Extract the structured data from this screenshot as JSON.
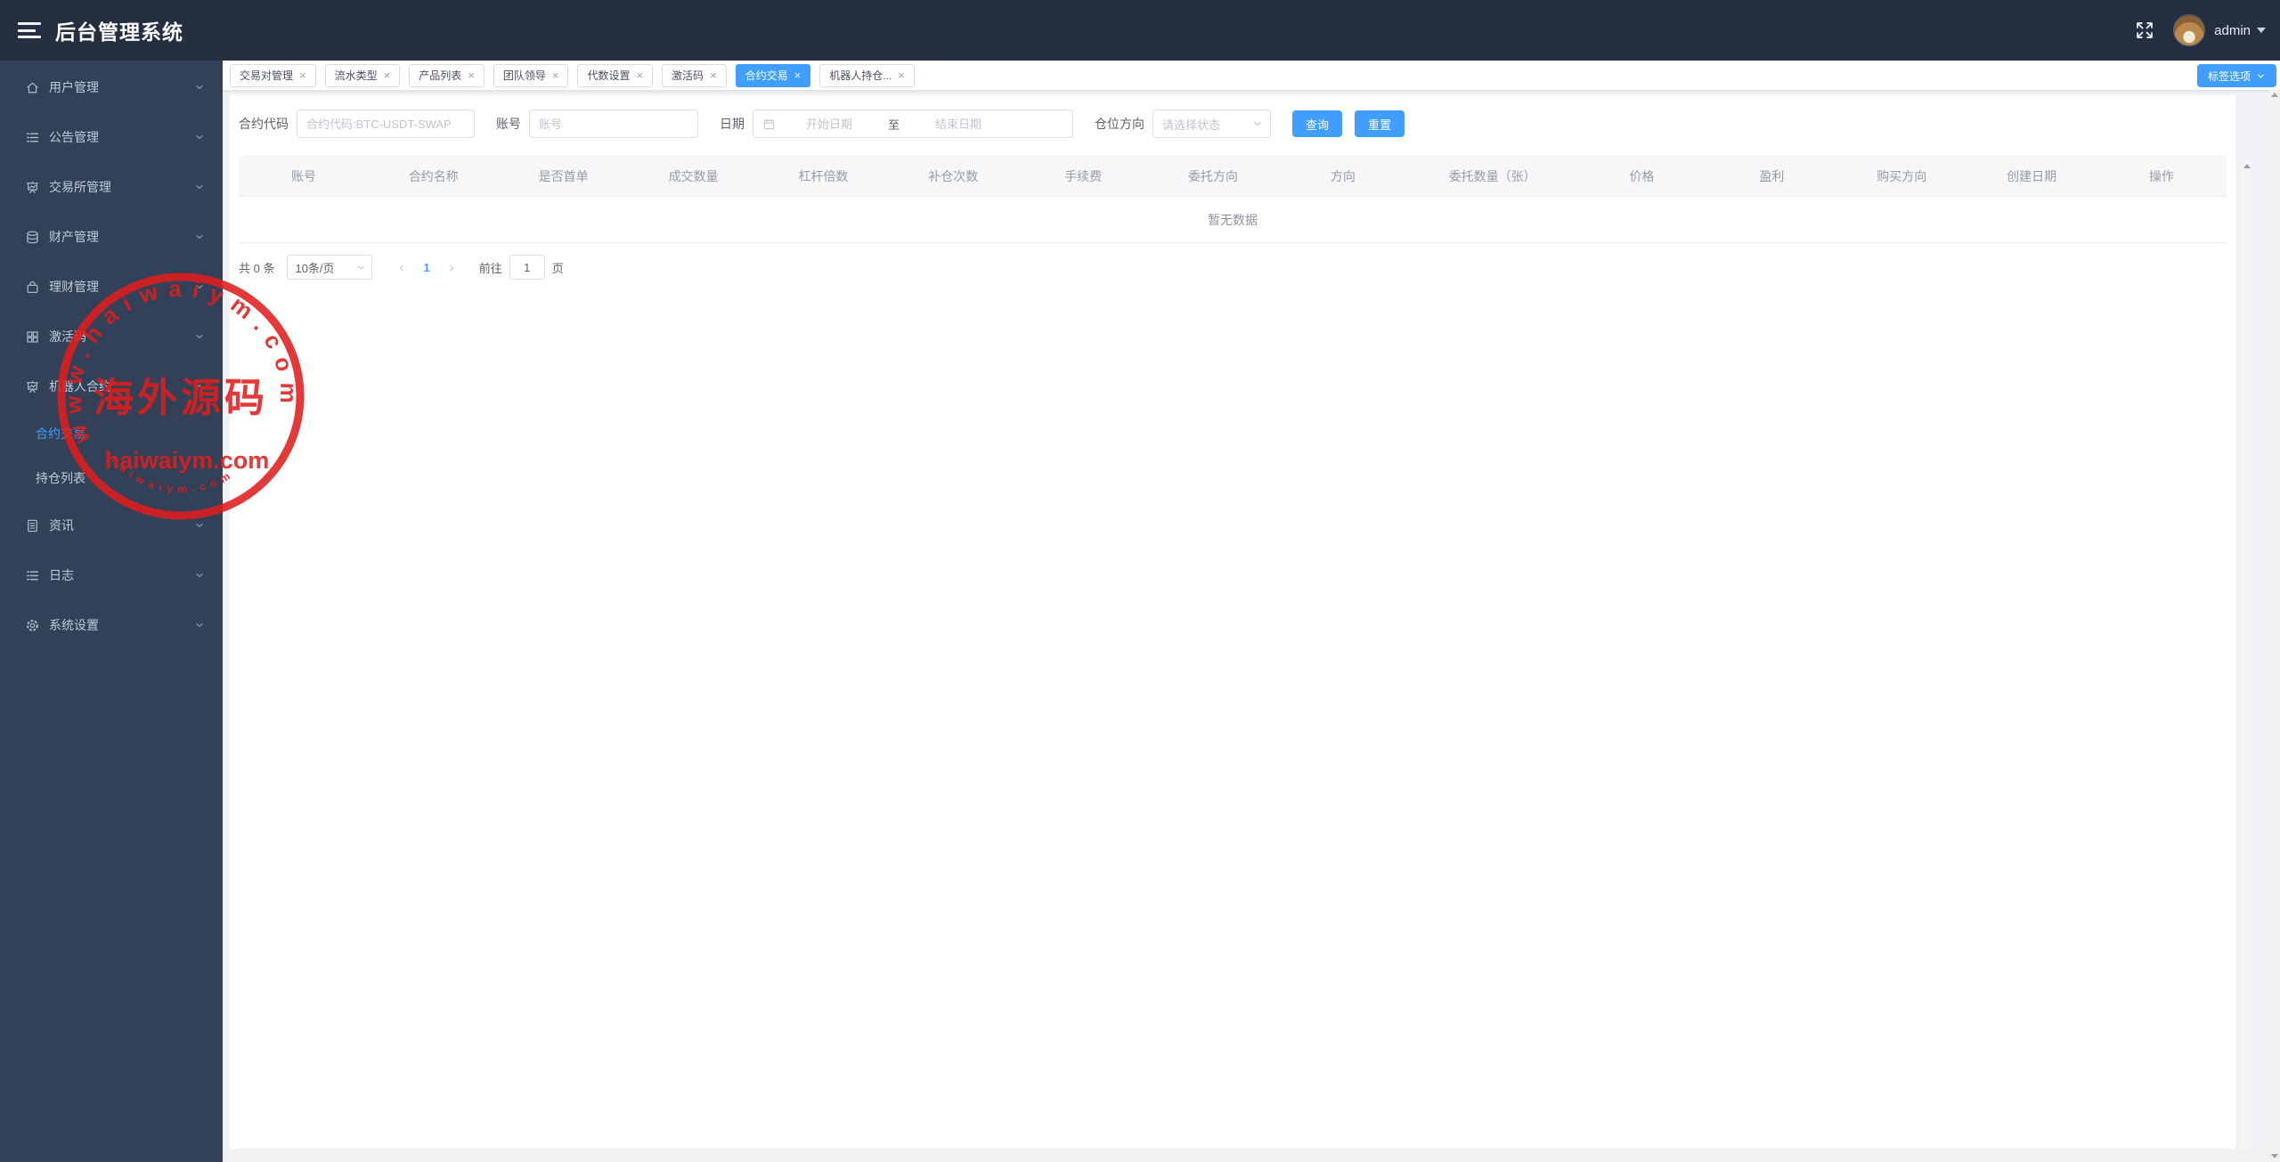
{
  "header": {
    "title": "后台管理系统",
    "username": "admin"
  },
  "sidebar": {
    "items": [
      {
        "label": "用户管理"
      },
      {
        "label": "公告管理"
      },
      {
        "label": "交易所管理"
      },
      {
        "label": "财产管理"
      },
      {
        "label": "理财管理"
      },
      {
        "label": "激活码"
      },
      {
        "label": "机器人合约"
      },
      {
        "label": "资讯"
      },
      {
        "label": "日志"
      },
      {
        "label": "系统设置"
      }
    ],
    "robot_children": [
      {
        "label": "合约交易",
        "active": true
      },
      {
        "label": "持仓列表",
        "active": false
      }
    ]
  },
  "tabbar": {
    "tabs": [
      {
        "label": "交易对管理"
      },
      {
        "label": "流水类型"
      },
      {
        "label": "产品列表"
      },
      {
        "label": "团队领导"
      },
      {
        "label": "代数设置"
      },
      {
        "label": "激活码"
      },
      {
        "label": "合约交易",
        "active": true
      },
      {
        "label": "机器人持仓..."
      }
    ],
    "close_glyph": "×",
    "options_label": "标签选项"
  },
  "filters": {
    "contract_code": {
      "label": "合约代码",
      "placeholder": "合约代码:BTC-USDT-SWAP",
      "value": ""
    },
    "account": {
      "label": "账号",
      "placeholder": "账号",
      "value": ""
    },
    "date": {
      "label": "日期",
      "start_placeholder": "开始日期",
      "separator": "至",
      "end_placeholder": "结束日期"
    },
    "position_direction": {
      "label": "仓位方向",
      "placeholder": "请选择状态"
    },
    "search_label": "查询",
    "reset_label": "重置"
  },
  "table": {
    "columns": [
      "账号",
      "合约名称",
      "是否首单",
      "成交数量",
      "杠杆倍数",
      "补仓次数",
      "手续费",
      "委托方向",
      "方向",
      "委托数量（张）",
      "价格",
      "盈利",
      "购买方向",
      "创建日期",
      "操作"
    ],
    "empty_text": "暂无数据"
  },
  "pagination": {
    "total_text": "共 0 条",
    "page_size": "10条/页",
    "prev_glyph": "‹",
    "next_glyph": "›",
    "current_page": "1",
    "goto_label": "前往",
    "goto_value": "1",
    "page_unit": "页"
  },
  "watermark": {
    "ring_text": "www.haiwaiym.com",
    "center_text": "海外源码",
    "site_text": "haiwaiym.com",
    "bottom_text": "haiwaiym.com",
    "color": "#e01e1e"
  },
  "colors": {
    "accent": "#409eff",
    "header_bg": "#242f42",
    "sidebar_bg": "#324157"
  }
}
